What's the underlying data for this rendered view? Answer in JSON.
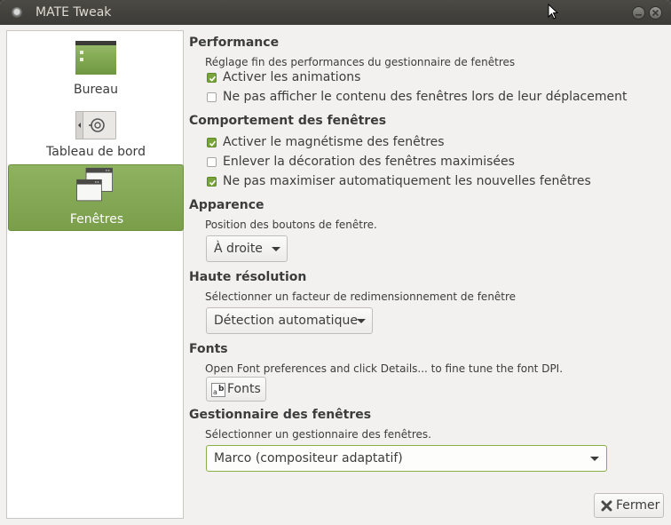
{
  "window": {
    "title": "MATE Tweak"
  },
  "sidebar": {
    "items": [
      {
        "label": "Bureau",
        "icon": "desktop-icon"
      },
      {
        "label": "Tableau de bord",
        "icon": "panel-icon"
      },
      {
        "label": "Fenêtres",
        "icon": "windows-icon",
        "selected": true
      }
    ]
  },
  "performance": {
    "title": "Performance",
    "desc": "Réglage fin des performances du gestionnaire de fenêtres",
    "options": [
      {
        "label": "Activer les animations",
        "checked": true
      },
      {
        "label": "Ne pas afficher le contenu des fenêtres lors de leur déplacement",
        "checked": false
      }
    ]
  },
  "behaviour": {
    "title": "Comportement des fenêtres",
    "options": [
      {
        "label": "Activer le magnétisme des fenêtres",
        "checked": true
      },
      {
        "label": "Enlever la décoration des fenêtres maximisées",
        "checked": false
      },
      {
        "label": "Ne pas maximiser automatiquement les nouvelles fenêtres",
        "checked": true
      }
    ]
  },
  "appearance": {
    "title": "Apparence",
    "desc": "Position des boutons de fenêtre.",
    "combo_value": "À droite"
  },
  "hidpi": {
    "title": "Haute résolution",
    "desc": "Sélectionner un facteur de redimensionnement de fenêtre",
    "combo_value": "Détection automatique"
  },
  "fonts": {
    "title": "Fonts",
    "desc": "Open Font preferences and click Details... to fine tune the font DPI.",
    "button_label": "Fonts"
  },
  "wm": {
    "title": "Gestionnaire des fenêtres",
    "desc": "Sélectionner un gestionnaire des fenêtres.",
    "combo_value": "Marco (compositeur adaptatif)"
  },
  "footer": {
    "close_label": "Fermer"
  },
  "colors": {
    "accent": "#7a9e4a",
    "titlebar": "#3c3b37",
    "check": "#78a33d"
  }
}
